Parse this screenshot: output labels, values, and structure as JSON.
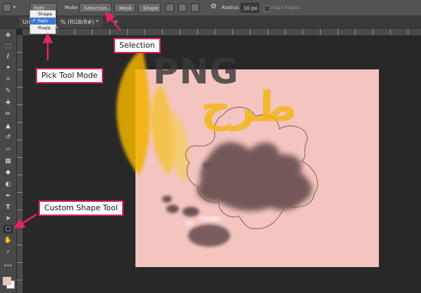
{
  "optionsBar": {
    "mode": "Path",
    "make_label": "Make:",
    "selection_button": "Selection...",
    "mask_button": "Mask",
    "shape_button": "Shape",
    "radius_label": "Radius:",
    "radius_value": "10 px",
    "align_edges": "Align Edges"
  },
  "modeMenu": {
    "items": [
      "Shape",
      "Path",
      "Pixels"
    ],
    "selected": "Path"
  },
  "document": {
    "tab_title_prefix": "Unt",
    "tab_title_suffix": "% (RGB/8#) *"
  },
  "watermark": {
    "text": "PNG",
    "arabic": "طرح"
  },
  "callouts": {
    "pick_tool_mode": "Pick Tool Mode",
    "selection": "Selection",
    "custom_shape_tool": "Custom Shape Tool"
  },
  "colors": {
    "accent": "#e2236b",
    "canvas": "#f3c4c0",
    "foreground": "#f3c2bd"
  }
}
